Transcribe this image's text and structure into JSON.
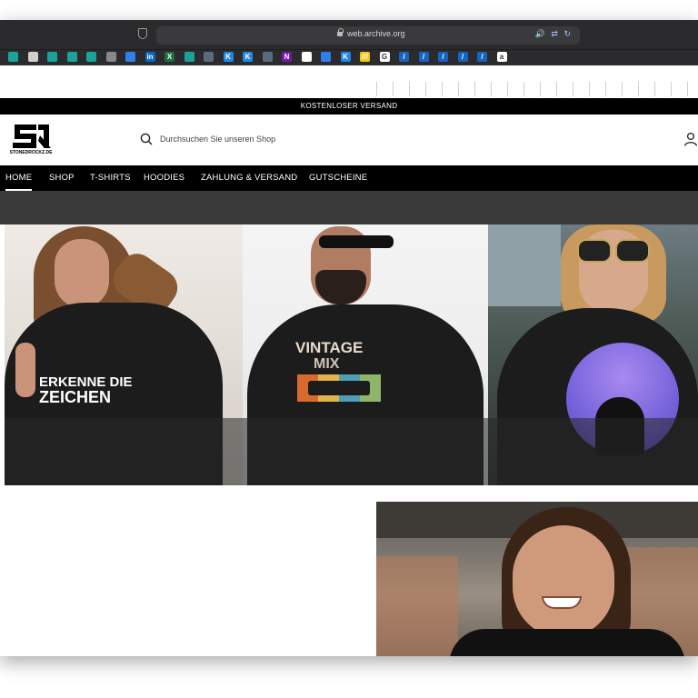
{
  "browser": {
    "url": "web.archive.org",
    "url_icons": "🔊 ⇄ ↻"
  },
  "bookmarks": [
    {
      "icon": "teal-app-icon",
      "color": "#1aa39a",
      "glyph": ""
    },
    {
      "icon": "doc-icon",
      "color": "#d0d0d0",
      "glyph": ""
    },
    {
      "icon": "teal-app-icon",
      "color": "#1aa39a",
      "glyph": ""
    },
    {
      "icon": "teal-app-icon",
      "color": "#1aa39a",
      "glyph": ""
    },
    {
      "icon": "teal-app-icon",
      "color": "#1aa39a",
      "glyph": ""
    },
    {
      "icon": "window-icon",
      "color": "#888888",
      "glyph": ""
    },
    {
      "icon": "blue-square-icon",
      "color": "#2f80ed",
      "glyph": ""
    },
    {
      "icon": "linkedin-icon",
      "color": "#0a66c2",
      "glyph": "in"
    },
    {
      "icon": "excel-icon",
      "color": "#1d6f42",
      "glyph": "X"
    },
    {
      "icon": "teal-app-icon",
      "color": "#1aa39a",
      "glyph": ""
    },
    {
      "icon": "layers-icon",
      "color": "#5b6b7a",
      "glyph": ""
    },
    {
      "icon": "k-icon",
      "color": "#1e88e5",
      "glyph": "K"
    },
    {
      "icon": "k-icon",
      "color": "#1e88e5",
      "glyph": "K"
    },
    {
      "icon": "layers-icon",
      "color": "#5b6b7a",
      "glyph": ""
    },
    {
      "icon": "onenote-icon",
      "color": "#7719aa",
      "glyph": "N"
    },
    {
      "icon": "github-icon",
      "color": "#ffffff",
      "glyph": ""
    },
    {
      "icon": "blue-square-icon",
      "color": "#2f80ed",
      "glyph": ""
    },
    {
      "icon": "k-icon",
      "color": "#1e88e5",
      "glyph": "K"
    },
    {
      "icon": "stripes-icon",
      "color": "#f5c518",
      "glyph": "///"
    },
    {
      "icon": "google-icon",
      "color": "#ffffff",
      "glyph": "G"
    },
    {
      "icon": "slash-icon",
      "color": "#1565c0",
      "glyph": "/"
    },
    {
      "icon": "slash-icon",
      "color": "#1565c0",
      "glyph": "/"
    },
    {
      "icon": "slash-icon",
      "color": "#1565c0",
      "glyph": "/"
    },
    {
      "icon": "slash-icon",
      "color": "#1565c0",
      "glyph": "/"
    },
    {
      "icon": "slash-icon",
      "color": "#1565c0",
      "glyph": "/"
    },
    {
      "icon": "amazon-icon",
      "color": "#ffffff",
      "glyph": "a"
    }
  ],
  "announcement": "KOSTENLOSER VERSAND",
  "brand": {
    "logo_text": "STONEDROCKZ.DE"
  },
  "search": {
    "placeholder": "Durchsuchen Sie unseren Shop"
  },
  "nav": [
    {
      "label": "HOME",
      "active": true
    },
    {
      "label": "SHOP",
      "active": false
    },
    {
      "label": "T-SHIRTS",
      "active": false
    },
    {
      "label": "HOODIES",
      "active": false
    },
    {
      "label": "ZAHLUNG & VERSAND",
      "active": false
    },
    {
      "label": "GUTSCHEINE",
      "active": false
    }
  ],
  "hero": {
    "print1_line1": "ERKENNE DIE",
    "print1_line2": "ZEICHEN",
    "print2_line1": "VINTAGE",
    "print2_line2": "MIX"
  },
  "colors": {
    "accent": "#000000",
    "nav_text": "#ffffff",
    "background": "#ffffff"
  }
}
